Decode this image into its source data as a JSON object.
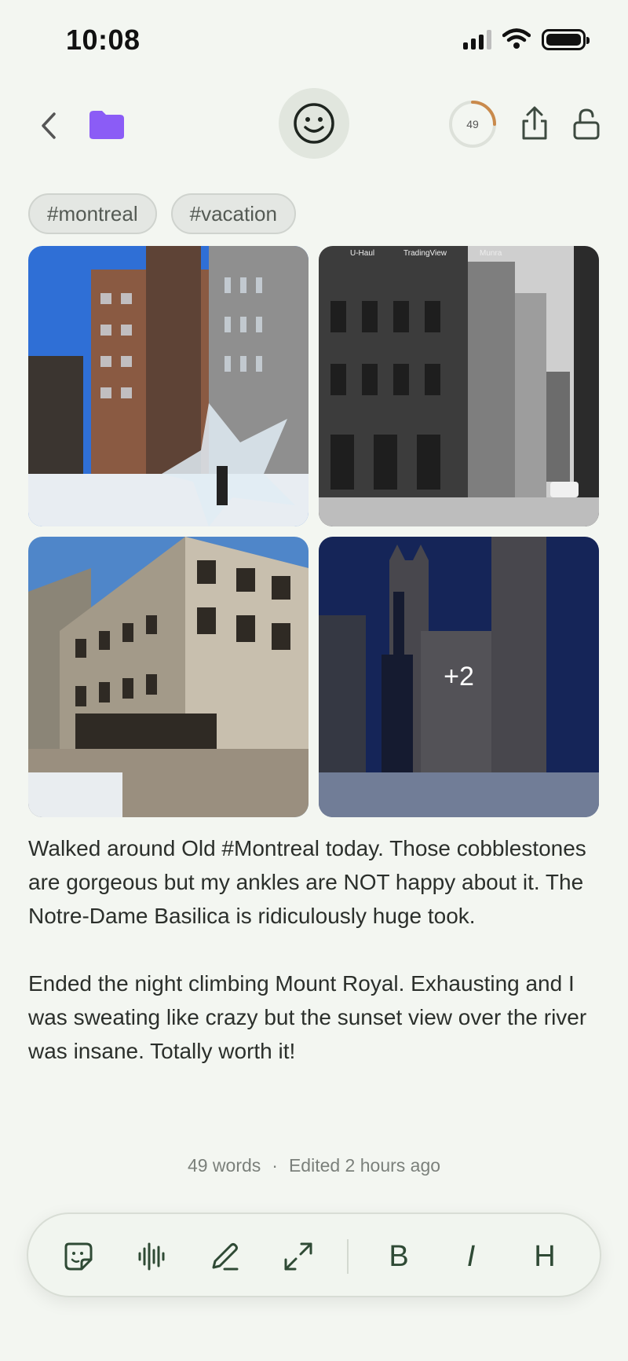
{
  "status": {
    "time": "10:08"
  },
  "colors": {
    "accent_folder": "#8b5cf6",
    "icon_dark": "#2f4a35",
    "progress": "#c98a4c"
  },
  "header": {
    "progress_value": 49,
    "progress_fraction": 0.25,
    "icons": [
      "chevron-left-icon",
      "folder-icon",
      "smiley-icon",
      "share-icon",
      "unlock-icon"
    ]
  },
  "tags": [
    "#montreal",
    "#vacation"
  ],
  "photos": {
    "overlay_label": "+2",
    "captions_photo2": [
      "U-Haul",
      "TradingView",
      "Munra"
    ]
  },
  "body": {
    "paragraphs": [
      "Walked around Old #Montreal today. Those cobblestones are gorgeous but my ankles are NOT happy about it. The Notre-Dame Basilica is ridiculously huge took.",
      "Ended the night climbing Mount Royal. Exhausting and I was sweating like crazy but the sunset view over the river was insane. Totally worth it!"
    ]
  },
  "meta": {
    "words": "49 words",
    "separator": "·",
    "edited": "Edited 2 hours ago"
  },
  "toolbar": {
    "bold": "B",
    "italic": "I",
    "heading": "H",
    "icons": [
      "sticker-icon",
      "audio-wave-icon",
      "pencil-icon",
      "expand-icon"
    ]
  }
}
